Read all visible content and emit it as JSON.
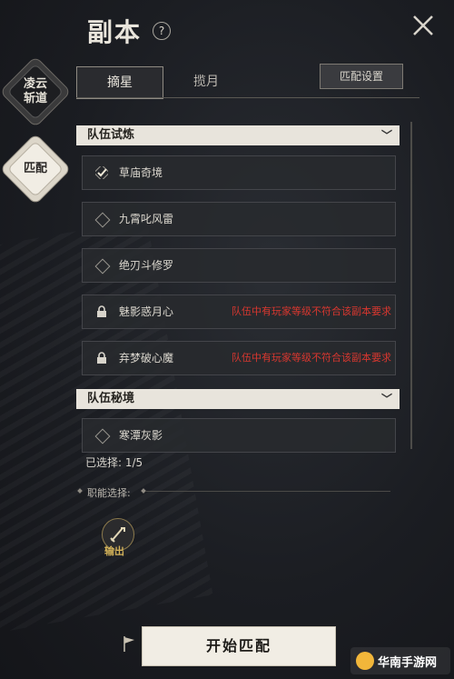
{
  "header": {
    "title": "副本",
    "help_symbol": "?"
  },
  "side_nav": [
    {
      "label": "凌云\n斩道"
    },
    {
      "label": "匹配"
    }
  ],
  "tabs": [
    {
      "label": "摘星"
    },
    {
      "label": "揽月"
    }
  ],
  "settings_button": "匹配设置",
  "sections": [
    {
      "title": "队伍试炼",
      "rows": [
        {
          "name": "草庙奇境",
          "status": "checked",
          "warning": ""
        },
        {
          "name": "九霄叱风雷",
          "status": "empty",
          "warning": ""
        },
        {
          "name": "绝刃斗修罗",
          "status": "empty",
          "warning": ""
        },
        {
          "name": "魅影惑月心",
          "status": "locked",
          "warning": "队伍中有玩家等级不符合该副本要求"
        },
        {
          "name": "弃梦破心魔",
          "status": "locked",
          "warning": "队伍中有玩家等级不符合该副本要求"
        }
      ]
    },
    {
      "title": "队伍秘境",
      "rows": [
        {
          "name": "寒潭灰影",
          "status": "empty",
          "warning": ""
        }
      ]
    }
  ],
  "selected_label": "已选择: 1/5",
  "role_selection_label": "职能选择:",
  "role": {
    "label": "输出",
    "icon": "sword-icon"
  },
  "start_button": "开始匹配",
  "watermark": "华南手游网",
  "colors": {
    "warning": "#d8372f",
    "role_gold": "#d4b35a"
  }
}
